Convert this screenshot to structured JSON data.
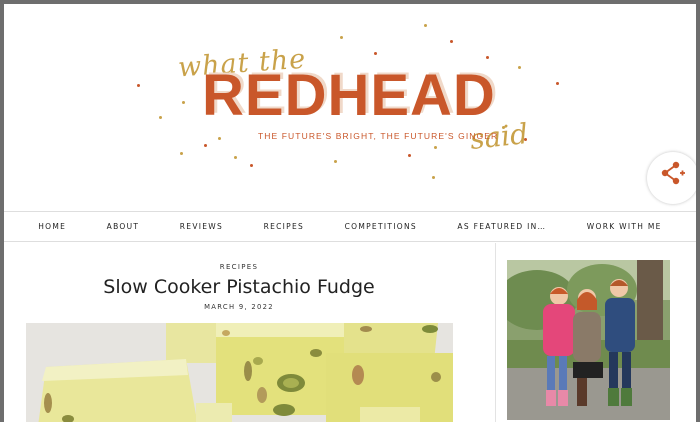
{
  "logo": {
    "script_top": "what the",
    "wordmark": "REDHEAD",
    "script_bottom": "said",
    "tagline": "THE FUTURE'S BRIGHT, THE FUTURE'S GINGER"
  },
  "nav": {
    "items": [
      {
        "label": "HOME"
      },
      {
        "label": "ABOUT"
      },
      {
        "label": "REVIEWS"
      },
      {
        "label": "RECIPES"
      },
      {
        "label": "COMPETITIONS"
      },
      {
        "label": "AS FEATURED IN…"
      },
      {
        "label": "WORK WITH ME"
      }
    ]
  },
  "post": {
    "category": "RECIPES",
    "title": "Slow Cooker Pistachio Fudge",
    "date": "MARCH 9, 2022"
  },
  "colors": {
    "brand_orange": "#c9572a",
    "brand_gold": "#c9a24a",
    "fudge_yellow": "#e2e07a"
  },
  "icons": {
    "share": "share-plus-icon"
  }
}
